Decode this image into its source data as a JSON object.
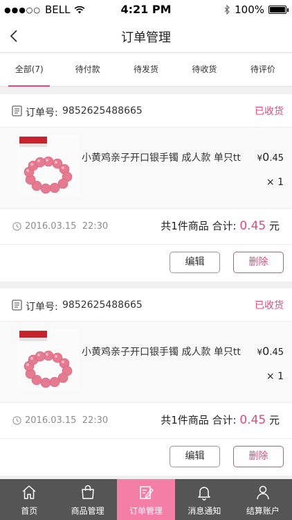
{
  "status_bar": {
    "carrier": "BELL",
    "signal_dots": "●●●○○",
    "time": "4:21 PM",
    "battery": "100%"
  },
  "header": {
    "title": "订单管理",
    "back_icon": "chevron-left-icon"
  },
  "tabs": [
    {
      "label": "全部(7)",
      "active": true
    },
    {
      "label": "待付款"
    },
    {
      "label": "待发货"
    },
    {
      "label": "待收货"
    },
    {
      "label": "待评价"
    }
  ],
  "orders": [
    {
      "order_no_label": "订单号:",
      "order_no": "9852625488665",
      "status": "已收货",
      "product_name": "小黄鸡亲子开口银手镯 成人款 单只tt",
      "price_currency": "¥",
      "price_int": "0",
      "price_dec": ".45",
      "quantity": "× 1",
      "date": "2016.03.15",
      "time": "22:30",
      "summary_prefix": "共1件商品 合计: ",
      "total": "0.45",
      "summary_suffix": " 元",
      "edit_label": "编辑",
      "delete_label": "删除"
    },
    {
      "order_no_label": "订单号:",
      "order_no": "9852625488665",
      "status": "已收货",
      "product_name": "小黄鸡亲子开口银手镯 成人款 单只tt",
      "price_currency": "¥",
      "price_int": "0",
      "price_dec": ".45",
      "quantity": "× 1",
      "date": "2016.03.15",
      "time": "22:30",
      "summary_prefix": "共1件商品 合计: ",
      "total": "0.45",
      "summary_suffix": " 元",
      "edit_label": "编辑",
      "delete_label": "删除"
    }
  ],
  "tabbar": [
    {
      "label": "首页",
      "icon": "home-icon"
    },
    {
      "label": "商品管理",
      "icon": "bag-icon"
    },
    {
      "label": "订单管理",
      "icon": "edit-document-icon",
      "active": true
    },
    {
      "label": "消息通知",
      "icon": "bell-icon"
    },
    {
      "label": "结算账户",
      "icon": "user-icon"
    }
  ],
  "colors": {
    "accent": "#e3487d",
    "tabbar_bg": "#555555",
    "tabbar_active": "#f37fa6"
  }
}
